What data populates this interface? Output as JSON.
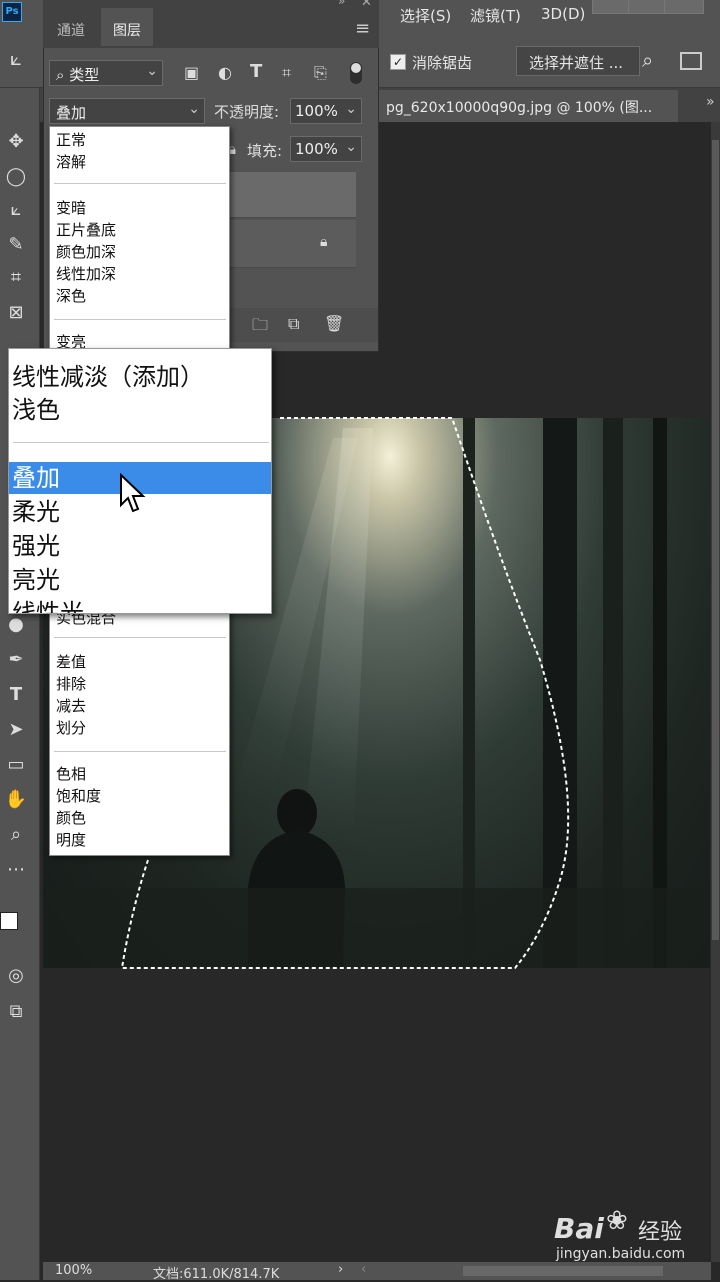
{
  "menubar": {
    "select": "选择(S)",
    "filter": "滤镜(T)",
    "threed": "3D(D)"
  },
  "options_bar": {
    "antialias_label": "消除锯齿",
    "select_mask_button": "选择并遮住 ..."
  },
  "document_tab": {
    "title": "pg_620x10000q90g.jpg @ 100% (图..."
  },
  "layers_panel": {
    "tabs": [
      "通道",
      "图层"
    ],
    "filter_kind": "类型",
    "blend_mode": "叠加",
    "opacity_label": "不透明度:",
    "opacity_value": "100%",
    "fill_label": "填充:",
    "fill_value": "100%"
  },
  "blend_menu": {
    "items": [
      "正常",
      "溶解",
      "变暗",
      "正片叠底",
      "颜色加深",
      "线性加深",
      "深色",
      "变亮",
      "实色混合",
      "差值",
      "排除",
      "减去",
      "划分",
      "色相",
      "饱和度",
      "颜色",
      "明度"
    ]
  },
  "zoom_menu": {
    "items": [
      "线性减淡（添加）",
      "浅色",
      "叠加",
      "柔光",
      "强光",
      "亮光",
      "线性光"
    ],
    "selected": "叠加"
  },
  "statusbar": {
    "zoom": "100%",
    "doc_info": "文档:611.0K/814.7K"
  },
  "watermark": {
    "brand": "Bai",
    "brand_cn": "经验",
    "url": "jingyan.baidu.com"
  },
  "icons": [
    "marquee-icon",
    "lasso-icon",
    "move-icon",
    "crop-icon",
    "text-icon",
    "hand-icon",
    "zoom-icon",
    "search-icon",
    "trash-icon",
    "folder-icon",
    "lock-icon"
  ]
}
